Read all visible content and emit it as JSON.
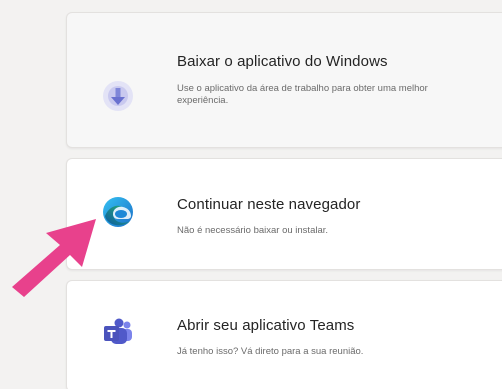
{
  "options": [
    {
      "title": "Baixar o aplicativo do Windows",
      "description": "Use o aplicativo da área de trabalho para obter uma melhor experiência.",
      "icon": "download-icon"
    },
    {
      "title": "Continuar neste navegador",
      "description": "Não é necessário baixar ou instalar.",
      "icon": "edge-browser-icon"
    },
    {
      "title": "Abrir seu aplicativo Teams",
      "description": "Já tenho isso? Vá direto para a sua reunião.",
      "icon": "teams-icon"
    }
  ],
  "colors": {
    "page_background": "#f3f2f1",
    "card_background": "#ffffff",
    "arrow": "#e8418c",
    "teams_purple": "#5059c9"
  }
}
